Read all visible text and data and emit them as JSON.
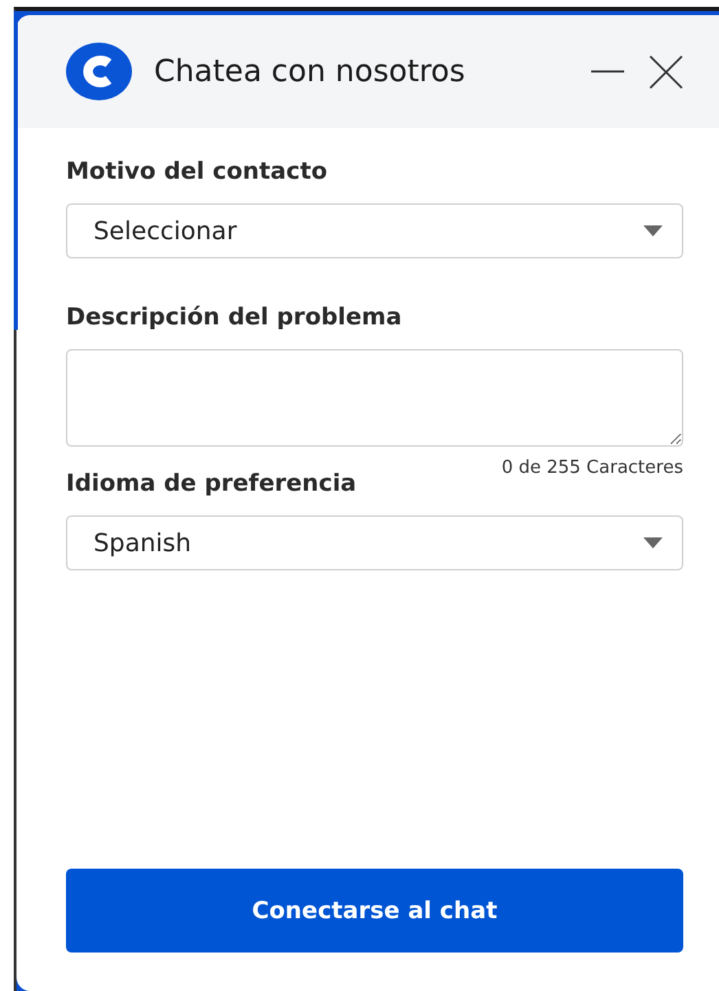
{
  "header": {
    "title": "Chatea con nosotros"
  },
  "fields": [
    {
      "kind": "select",
      "label": "Motivo del contacto",
      "value": "Seleccionar"
    },
    {
      "kind": "textarea",
      "label": "Descripción del problema",
      "counter": "0 de 255 Caracteres"
    },
    {
      "kind": "select",
      "label": "Idioma de preferencia",
      "value": "Spanish"
    }
  ],
  "submit_button": "Conectarse al chat"
}
